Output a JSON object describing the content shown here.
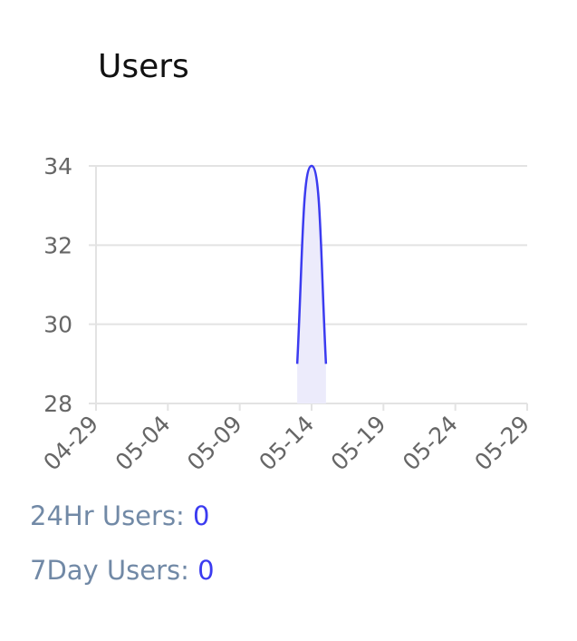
{
  "header": {
    "title": "Users"
  },
  "stats": {
    "day": {
      "label": "24Hr Users:",
      "value": "0"
    },
    "week": {
      "label": "7Day Users:",
      "value": "0"
    }
  },
  "colors": {
    "line": "#3b3bf0",
    "fill": "#ecebfb",
    "grid": "#e3e3e3",
    "tick_text": "#666666"
  },
  "chart_data": {
    "type": "area",
    "title": "Users",
    "xlabel": "",
    "ylabel": "",
    "x_ticks": [
      "04-29",
      "05-04",
      "05-09",
      "05-14",
      "05-19",
      "05-24",
      "05-29"
    ],
    "y_ticks": [
      28,
      30,
      32,
      34
    ],
    "ylim": [
      28,
      34
    ],
    "xlim": [
      "04-29",
      "05-29"
    ],
    "grid": true,
    "series": [
      {
        "x": [
          "05-13",
          "05-14",
          "05-15"
        ],
        "values": [
          29,
          34,
          29
        ]
      }
    ]
  }
}
